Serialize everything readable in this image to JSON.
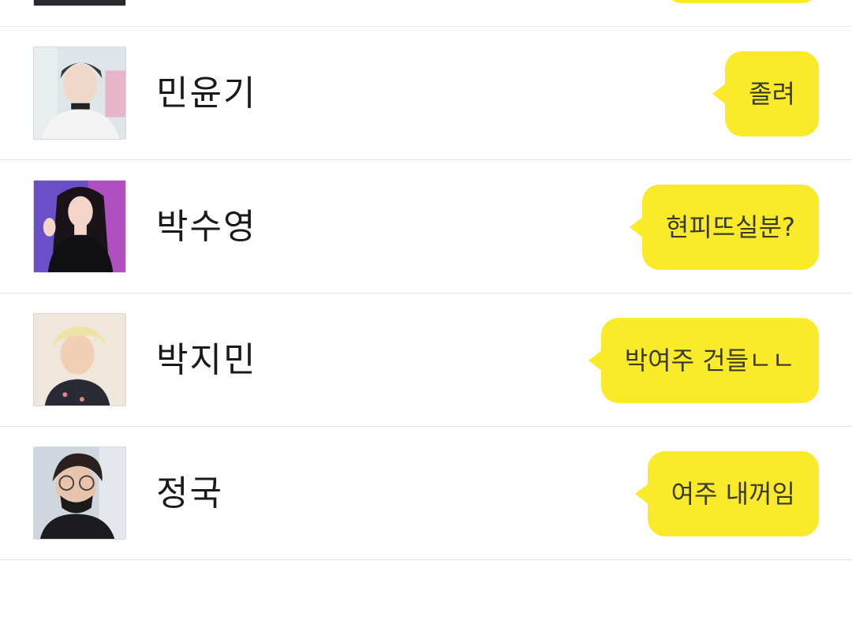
{
  "friends": [
    {
      "name": "",
      "message": "",
      "avatar_icon": "profile-photo"
    },
    {
      "name": "민윤기",
      "message": "졸려",
      "avatar_icon": "profile-photo"
    },
    {
      "name": "박수영",
      "message": "현피뜨실분?",
      "avatar_icon": "profile-photo"
    },
    {
      "name": "박지민",
      "message": "박여주 건들ㄴㄴ",
      "avatar_icon": "profile-photo"
    },
    {
      "name": "정국",
      "message": "여주 내꺼임",
      "avatar_icon": "profile-photo"
    }
  ],
  "colors": {
    "bubble": "#f9ea2a",
    "divider": "#e6e6e6",
    "name_text": "#1a1a1a"
  }
}
